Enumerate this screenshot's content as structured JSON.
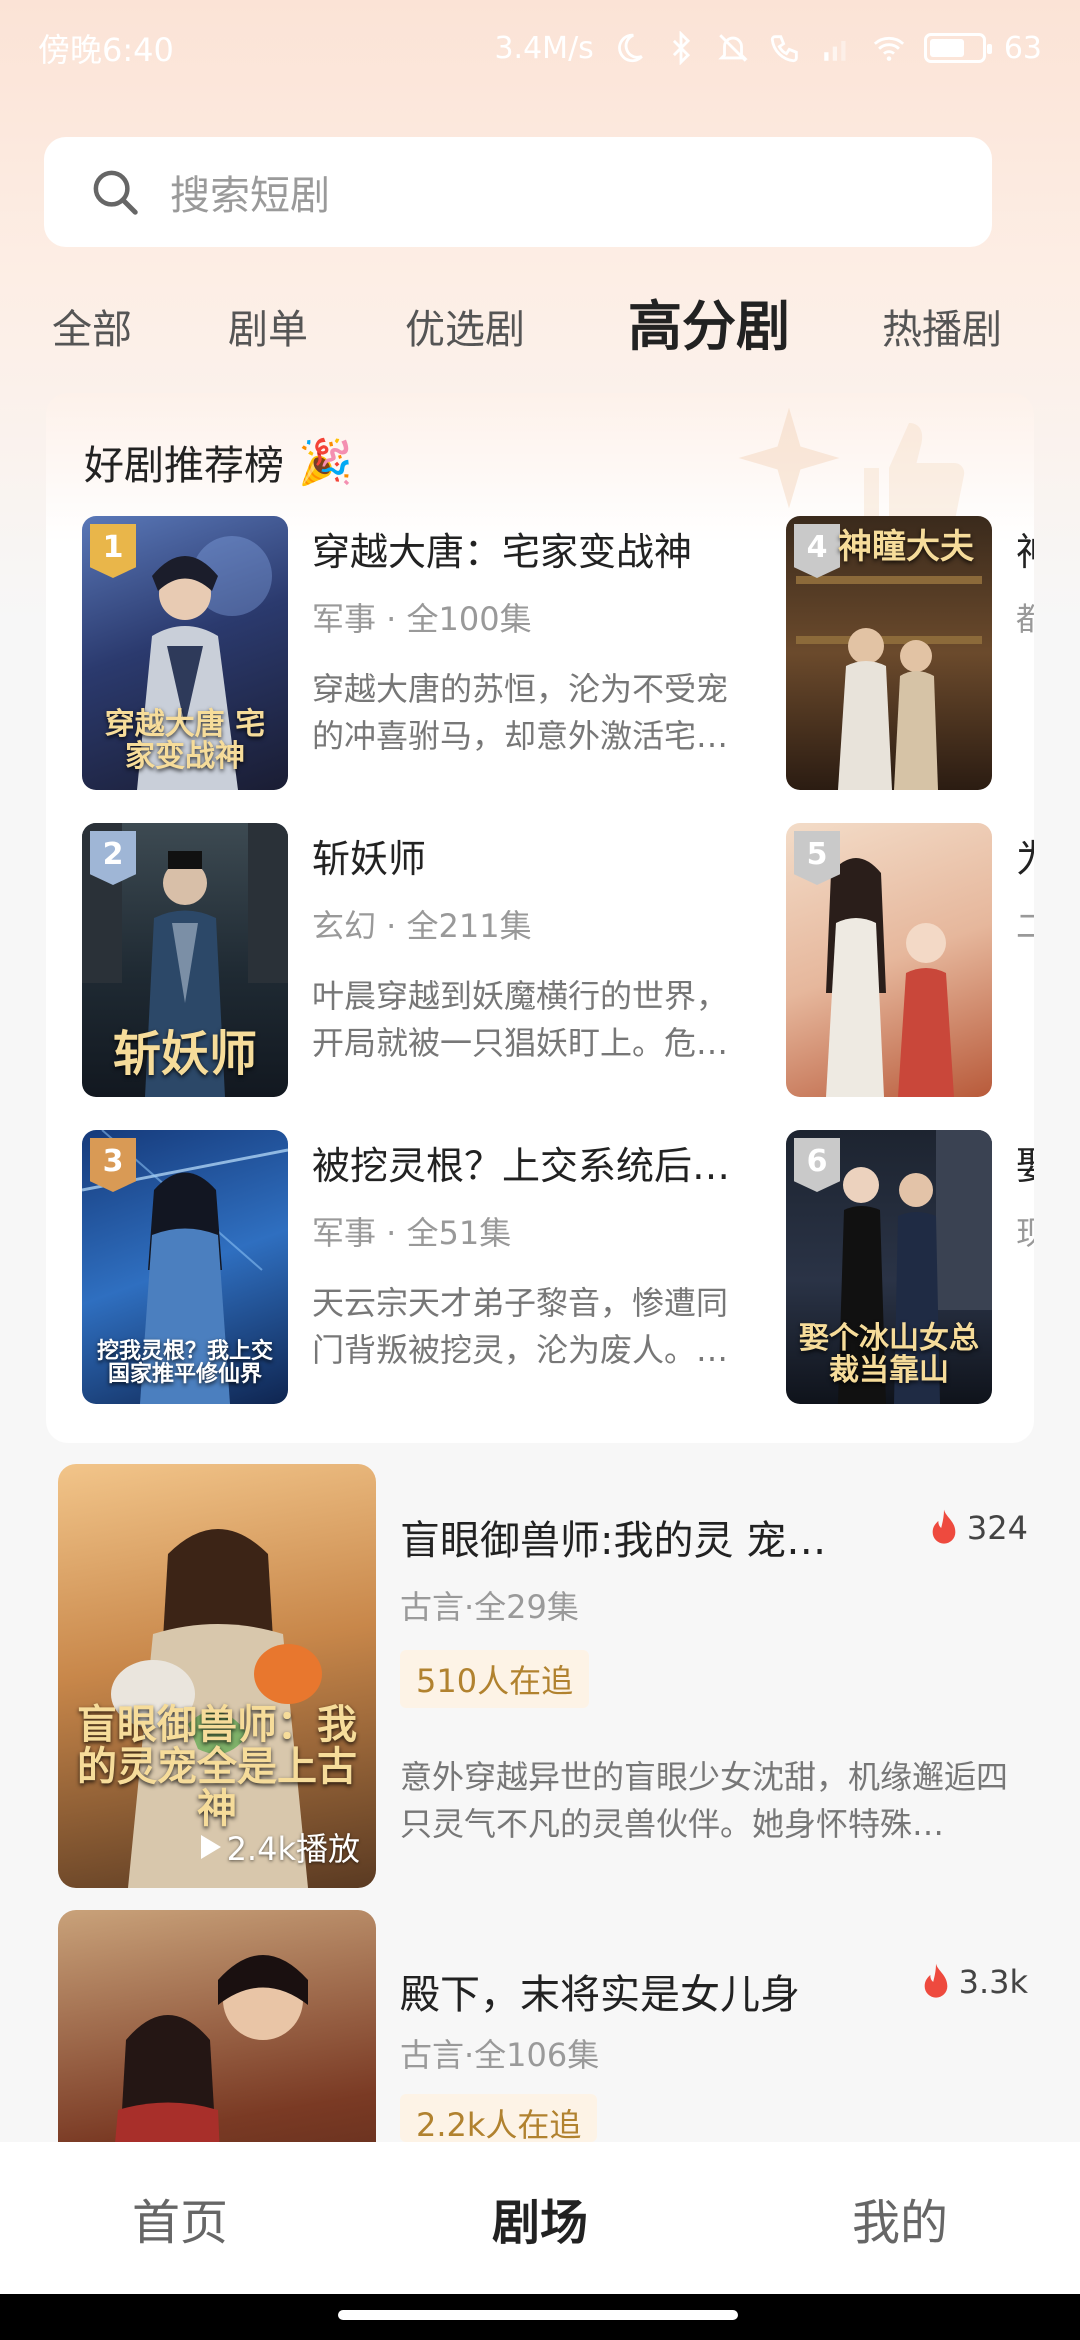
{
  "status_bar": {
    "time": "傍晚6:40",
    "speed": "3.4M/s",
    "battery": "63"
  },
  "search": {
    "placeholder": "搜索短剧"
  },
  "tabs": [
    {
      "label": "全部",
      "active": false
    },
    {
      "label": "剧单",
      "active": false
    },
    {
      "label": "优选剧",
      "active": false
    },
    {
      "label": "高分剧",
      "active": true
    },
    {
      "label": "热播剧",
      "active": false
    }
  ],
  "ranking": {
    "title": "好剧推荐榜",
    "title_emoji": "🎉",
    "items": [
      {
        "rank": "1",
        "name": "穿越大唐：宅家变战神",
        "meta": "军事 · 全100集",
        "desc": "穿越大唐的苏恒，沦为不受宠的冲喜驸马，却意外激活宅…",
        "cover_text": "穿越大唐 宅家变战神",
        "badge_color": "#e9b64a"
      },
      {
        "rank": "2",
        "name": "斩妖师",
        "meta": "玄幻 · 全211集",
        "desc": "叶晨穿越到妖魔横行的世界，开局就被一只猖妖盯上。危…",
        "cover_text": "斩妖师",
        "badge_color": "#9fb6d6"
      },
      {
        "rank": "3",
        "name": "被挖灵根？上交系统后…",
        "meta": "军事 · 全51集",
        "desc": "天云宗天才弟子黎音，惨遭同门背叛被挖灵，沦为废人。…",
        "cover_text": "挖我灵根？我上交国家推平修仙界",
        "badge_color": "#d99a55"
      },
      {
        "rank": "4",
        "name": "神",
        "meta": "都",
        "desc": "",
        "cover_text": "神瞳大夫",
        "badge_color": "#c9c9c9"
      },
      {
        "rank": "5",
        "name": "为",
        "meta": "二",
        "desc": "",
        "cover_text": "",
        "badge_color": "#c9c9c9"
      },
      {
        "rank": "6",
        "name": "娶",
        "meta": "现",
        "desc": "",
        "cover_text": "娶个冰山女总裁当靠山",
        "badge_color": "#c9c9c9"
      }
    ]
  },
  "feed": [
    {
      "title": "盲眼御兽师:我的灵 宠…",
      "hot": "324",
      "meta": "古言·全29集",
      "tag": "510人在追",
      "desc": "意外穿越异世的盲眼少女沈甜，机缘邂逅四只灵气不凡的灵兽伙伴。她身怀特殊…",
      "plays": "2.4k播放",
      "cover_text": "盲眼御兽师：我的灵宠全是上古神"
    },
    {
      "title": "殿下，末将实是女儿身",
      "hot": "3.3k",
      "meta": "古言·全106集",
      "tag": "2.2k人在追",
      "desc": "",
      "plays": "",
      "cover_text": ""
    }
  ],
  "bottom_nav": [
    {
      "label": "首页",
      "active": false
    },
    {
      "label": "剧场",
      "active": true
    },
    {
      "label": "我的",
      "active": false
    }
  ]
}
